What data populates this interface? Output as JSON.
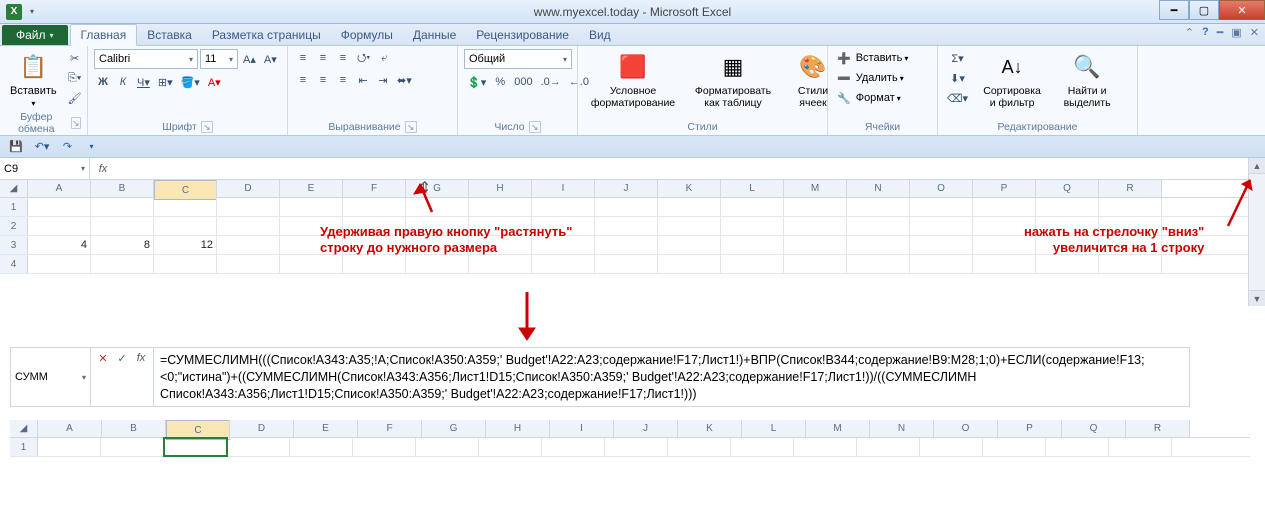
{
  "window": {
    "title": "www.myexcel.today  -  Microsoft Excel",
    "excel_letter": "X"
  },
  "tabs": {
    "file": "Файл",
    "items": [
      "Главная",
      "Вставка",
      "Разметка страницы",
      "Формулы",
      "Данные",
      "Рецензирование",
      "Вид"
    ],
    "active_index": 0
  },
  "ribbon": {
    "clipboard": {
      "title": "Буфер обмена",
      "paste": "Вставить"
    },
    "font": {
      "title": "Шрифт",
      "name": "Calibri",
      "size": "11"
    },
    "alignment": {
      "title": "Выравнивание"
    },
    "number": {
      "title": "Число",
      "format": "Общий"
    },
    "styles": {
      "title": "Стили",
      "cond": "Условное форматирование",
      "table": "Форматировать как таблицу",
      "cell": "Стили ячеек"
    },
    "cells": {
      "title": "Ячейки",
      "insert": "Вставить",
      "delete": "Удалить",
      "format": "Формат"
    },
    "editing": {
      "title": "Редактирование",
      "sort": "Сортировка и фильтр",
      "find": "Найти и выделить"
    }
  },
  "namebox1": "C9",
  "namebox2": "СУММ",
  "formula2": "=СУММЕСЛИМН(((Список!A343:A35;!A;Список!A350:A359;' Budget'!A22:A23;содержание!F17;Лист1!)+ВПР(Список!B344;содержание!B9:M28;1;0)+ЕСЛИ(содержание!F13;<0;\"истина\")+((СУММЕСЛИМН(Список!A343:A356;Лист1!D15;Список!A350:A359;' Budget'!A22:A23;содержание!F17;Лист1!))/((СУММЕСЛИМН Список!A343:A356;Лист1!D15;Список!A350:A359;' Budget'!A22:A23;содержание!F17;Лист1!)))",
  "columns": [
    "A",
    "B",
    "C",
    "D",
    "E",
    "F",
    "G",
    "H",
    "I",
    "J",
    "K",
    "L",
    "M",
    "N",
    "O",
    "P",
    "Q",
    "R"
  ],
  "columns2": [
    "A",
    "B",
    "C",
    "D",
    "E",
    "F",
    "G",
    "H",
    "I",
    "J",
    "K",
    "L",
    "M",
    "N",
    "O",
    "P",
    "Q",
    "R"
  ],
  "grid": {
    "selected_col": "C",
    "rows": [
      {
        "n": "1",
        "cells": [
          "",
          "",
          "",
          "",
          "",
          "",
          "",
          "",
          "",
          "",
          "",
          "",
          "",
          "",
          "",
          "",
          "",
          ""
        ]
      },
      {
        "n": "2",
        "cells": [
          "",
          "",
          "",
          "",
          "",
          "",
          "",
          "",
          "",
          "",
          "",
          "",
          "",
          "",
          "",
          "",
          "",
          ""
        ]
      },
      {
        "n": "3",
        "cells": [
          "4",
          "8",
          "12",
          "",
          "",
          "",
          "",
          "",
          "",
          "",
          "",
          "",
          "",
          "",
          "",
          "",
          "",
          ""
        ]
      },
      {
        "n": "4",
        "cells": [
          "",
          "",
          "",
          "",
          "",
          "",
          "",
          "",
          "",
          "",
          "",
          "",
          "",
          "",
          "",
          "",
          "",
          ""
        ]
      }
    ]
  },
  "annotation1_line1": "Удерживая правую кнопку \"растянуть\"",
  "annotation1_line2": "строку до нужного размера",
  "annotation2_line1": "нажать на стрелочку \"вниз\"",
  "annotation2_line2": "увеличится на 1 строку",
  "grid2_row1": "1"
}
